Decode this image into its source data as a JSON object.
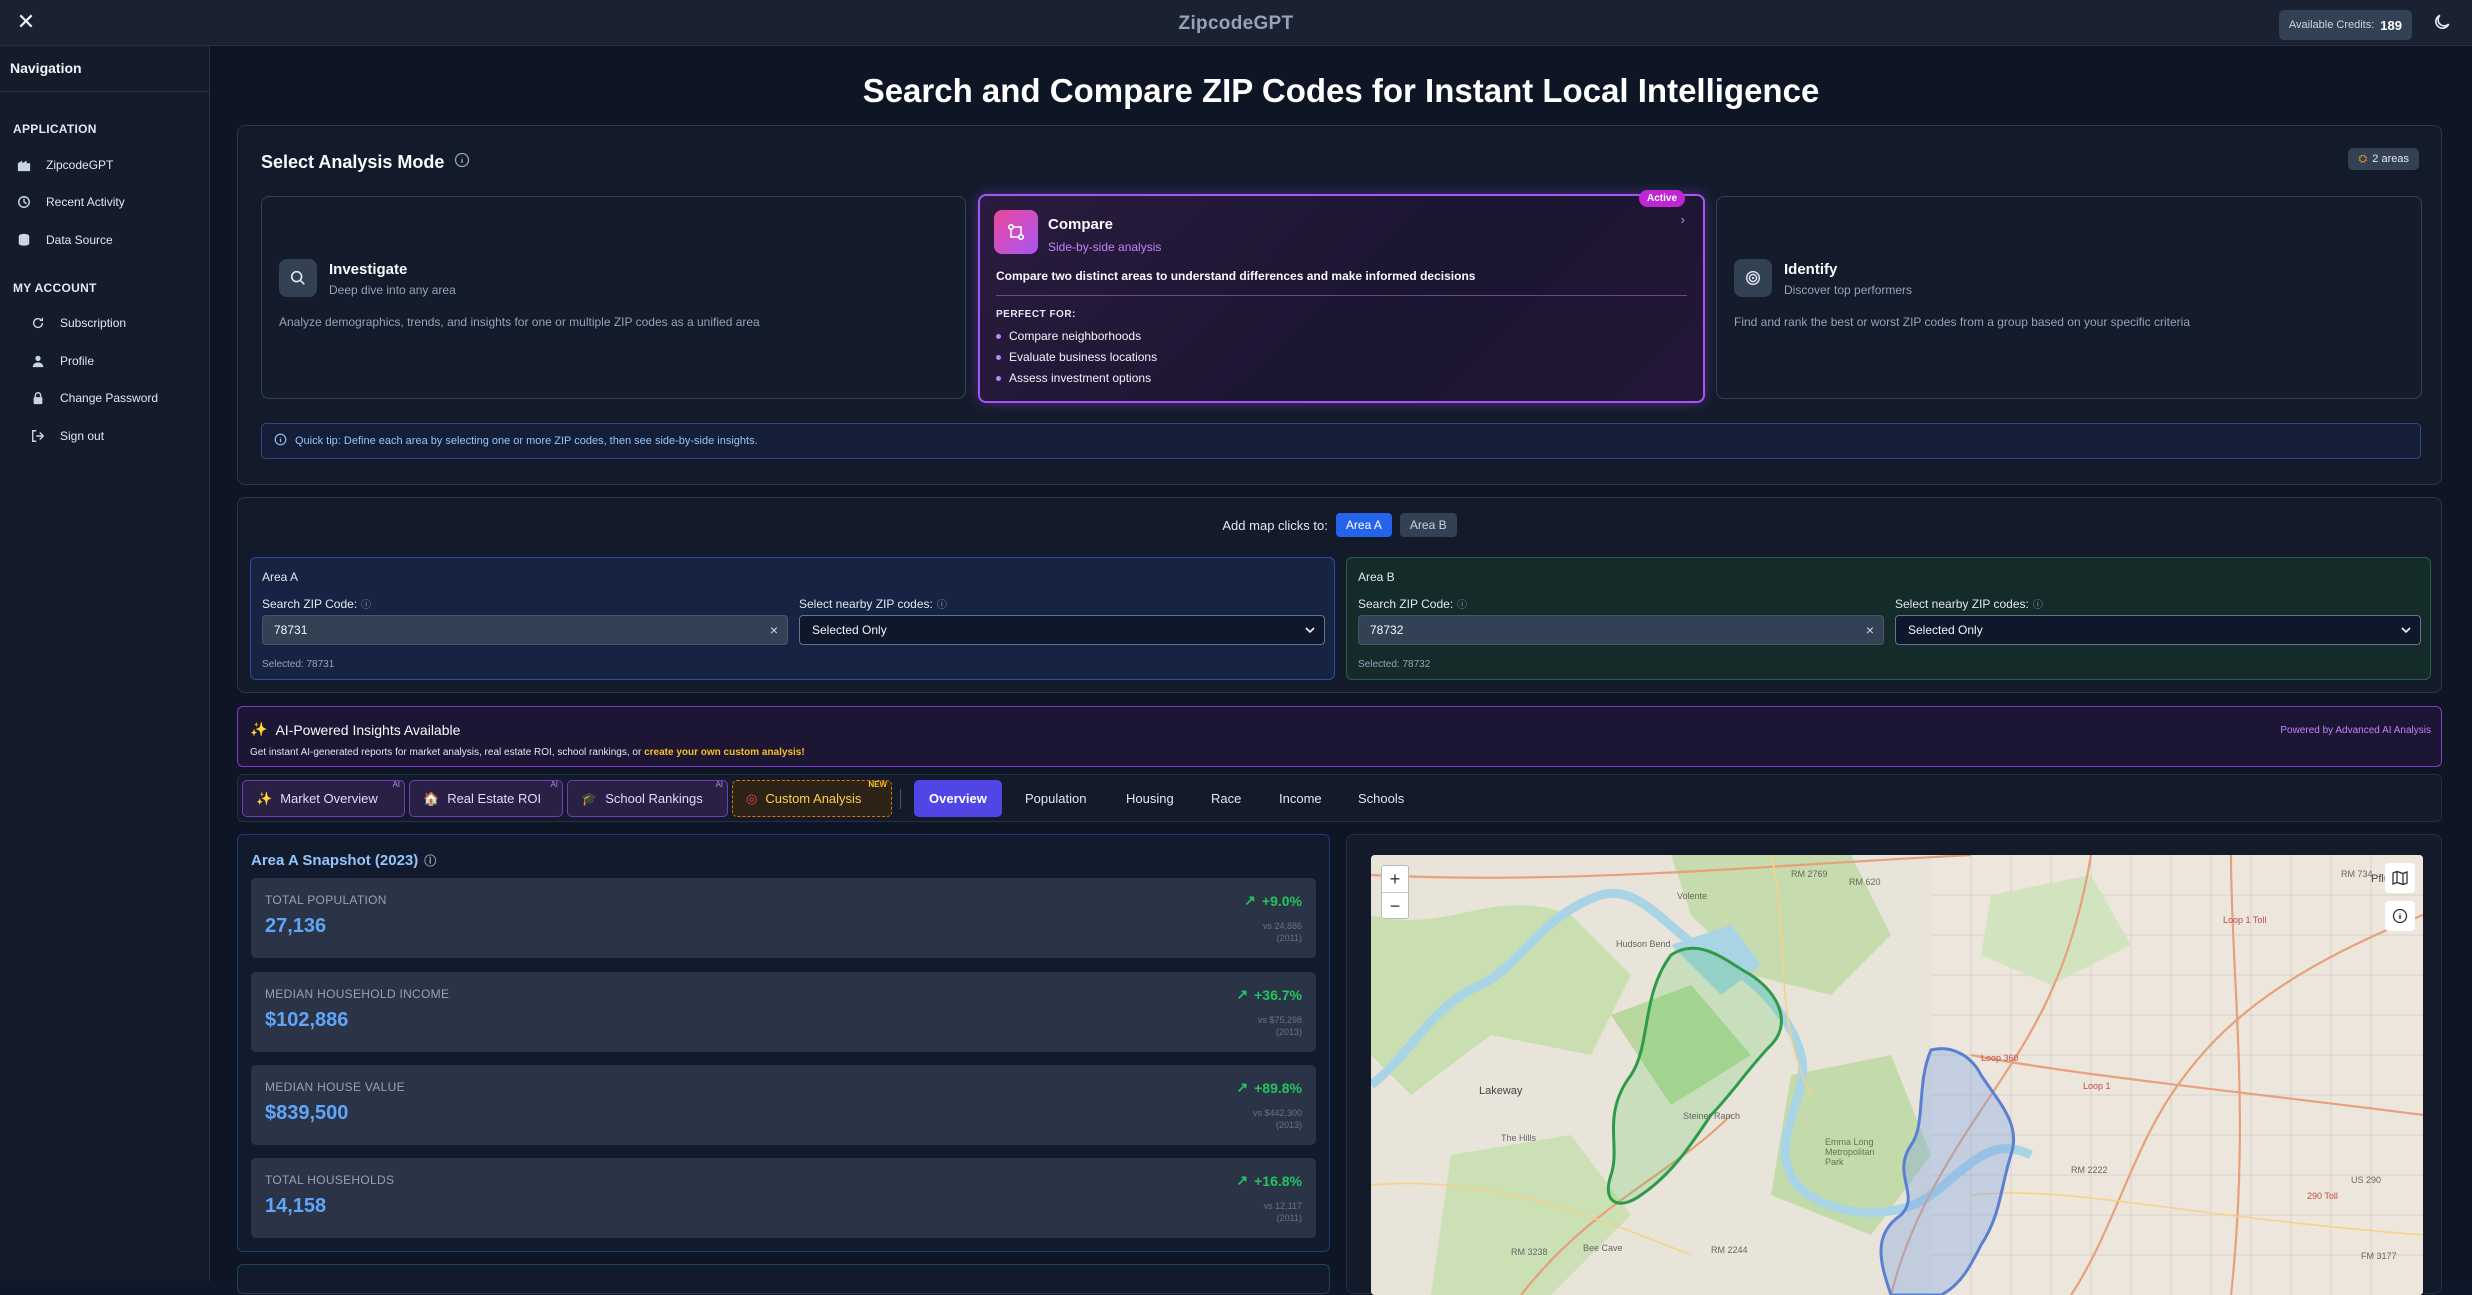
{
  "app": {
    "title": "ZipcodeGPT",
    "credits_label": "Available Credits:",
    "credits_value": "189"
  },
  "sidebar": {
    "heading": "Navigation",
    "sections": [
      {
        "title": "APPLICATION",
        "items": [
          "ZipcodeGPT",
          "Recent Activity",
          "Data Source"
        ]
      },
      {
        "title": "MY ACCOUNT",
        "items": [
          "Subscription",
          "Profile",
          "Change Password",
          "Sign out"
        ]
      }
    ]
  },
  "page": {
    "title": "Search and Compare ZIP Codes for Instant Local Intelligence"
  },
  "modes": {
    "title": "Select Analysis Mode",
    "areas_badge": "2 areas",
    "investigate": {
      "name": "Investigate",
      "sub": "Deep dive into any area",
      "desc": "Analyze demographics, trends, and insights for one or multiple ZIP codes as a unified area"
    },
    "compare": {
      "name": "Compare",
      "sub": "Side-by-side analysis",
      "badge": "Active",
      "desc": "Compare two distinct areas to understand differences and make informed decisions",
      "perfect_for": "PERFECT FOR:",
      "bullets": [
        "Compare neighborhoods",
        "Evaluate business locations",
        "Assess investment options"
      ]
    },
    "identify": {
      "name": "Identify",
      "sub": "Discover top performers",
      "desc": "Find and rank the best or worst ZIP codes from a group based on your specific criteria"
    },
    "tip": "Quick tip: Define each area by selecting one or more ZIP codes, then see side-by-side insights."
  },
  "areas": {
    "map_clicks_label": "Add map clicks to:",
    "pill_a": "Area A",
    "pill_b": "Area B",
    "a": {
      "name": "Area A",
      "zip_label": "Search ZIP Code:",
      "zip_value": "78731",
      "nearby_label": "Select nearby ZIP codes:",
      "nearby_value": "Selected Only",
      "selected": "Selected: 78731"
    },
    "b": {
      "name": "Area B",
      "zip_label": "Search ZIP Code:",
      "zip_value": "78732",
      "nearby_label": "Select nearby ZIP codes:",
      "nearby_value": "Selected Only",
      "selected": "Selected: 78732"
    }
  },
  "ai": {
    "title": "AI-Powered Insights Available",
    "sub_prefix": "Get instant AI-generated reports for market analysis, real estate ROI, school rankings, or ",
    "sub_link": "create your own custom analysis!",
    "powered": "Powered by Advanced AI Analysis"
  },
  "tabs": {
    "ai": [
      {
        "label": "Market Overview",
        "sup": "AI"
      },
      {
        "label": "Real Estate ROI",
        "sup": "AI"
      },
      {
        "label": "School Rankings",
        "sup": "AI"
      },
      {
        "label": "Custom Analysis",
        "sup": "NEW"
      }
    ],
    "views": [
      "Overview",
      "Population",
      "Housing",
      "Race",
      "Income",
      "Schools"
    ]
  },
  "snapshot": {
    "title": "Area A Snapshot (2023)",
    "metrics": [
      {
        "label": "TOTAL POPULATION",
        "value": "27,136",
        "delta": "+9.0%",
        "cmp1": "vs 24,886",
        "cmp2": "(2011)"
      },
      {
        "label": "MEDIAN HOUSEHOLD INCOME",
        "value": "$102,886",
        "delta": "+36.7%",
        "cmp1": "vs $75,298",
        "cmp2": "(2013)"
      },
      {
        "label": "MEDIAN HOUSE VALUE",
        "value": "$839,500",
        "delta": "+89.8%",
        "cmp1": "vs $442,300",
        "cmp2": "(2013)"
      },
      {
        "label": "TOTAL HOUSEHOLDS",
        "value": "14,158",
        "delta": "+16.8%",
        "cmp1": "vs 12,117",
        "cmp2": "(2011)"
      }
    ]
  },
  "map": {
    "labels": [
      "RM 2769",
      "RM 620",
      "Volente",
      "Hudson Bend",
      "Lakeway",
      "The Hills",
      "Steiner Ranch",
      "Emma Long Metropolitan Park",
      "Bee Cave",
      "RM 2244",
      "RM 3238",
      "Loop 1 Toll",
      "Loop 360",
      "Loop 1",
      "RM 2222",
      "290 Toll",
      "US 290",
      "RM 734",
      "Pflu",
      "FM 3177"
    ],
    "colors": {
      "water": "#a8d4e6",
      "park": "#b8dba0",
      "area_a": "#6b8ed6",
      "area_b": "#2e9a4a"
    }
  }
}
